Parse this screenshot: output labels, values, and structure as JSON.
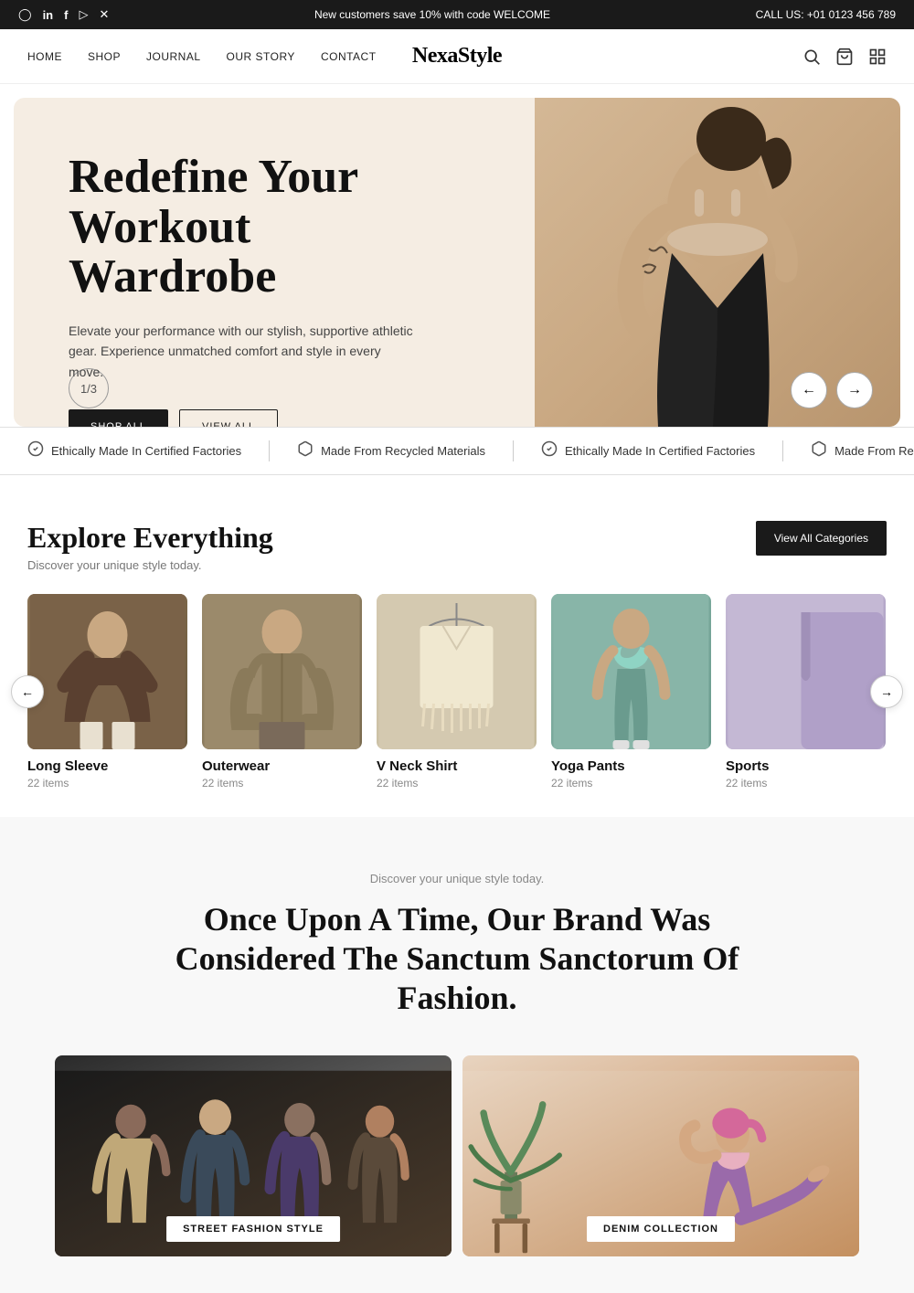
{
  "topbar": {
    "promo": "New customers save 10% with code WELCOME",
    "call": "CALL US: +01 0123 456 789",
    "social": [
      "instagram",
      "linkedin",
      "facebook",
      "youtube",
      "x"
    ]
  },
  "nav": {
    "logo": "NexaStyle",
    "links": [
      "HOME",
      "SHOP",
      "JOURNAL",
      "OUR STORY",
      "CONTACT"
    ]
  },
  "hero": {
    "title": "Redefine Your Workout Wardrobe",
    "subtitle": "Elevate your performance with our stylish, supportive athletic gear. Experience unmatched comfort and style in every move.",
    "btn_shop": "SHOP ALL",
    "btn_view": "VIEW ALL",
    "slide_indicator": "1/3"
  },
  "ticker": {
    "items": [
      {
        "icon": "✓",
        "label": "Ethically Made In Certified Factories"
      },
      {
        "icon": "♻",
        "label": "Made From Recycled Materials"
      },
      {
        "icon": "✓",
        "label": "Ethically Made In Certified Factories"
      },
      {
        "icon": "♻",
        "label": "Made From Recycled Materials"
      }
    ]
  },
  "explore": {
    "title": "Explore Everything",
    "subtitle": "Discover your unique style today.",
    "view_all_btn": "View All Categories",
    "categories": [
      {
        "name": "Long Sleeve",
        "count": "22 items"
      },
      {
        "name": "Outerwear",
        "count": "22 items"
      },
      {
        "name": "V Neck Shirt",
        "count": "22 items"
      },
      {
        "name": "Yoga Pants",
        "count": "22 items"
      },
      {
        "name": "Sports",
        "count": "22 items"
      }
    ]
  },
  "brand_story": {
    "sub": "Discover your unique style today.",
    "title": "Once Upon A Time, Our Brand Was Considered The Sanctum Sanctorum Of Fashion.",
    "collections": [
      {
        "label": "STREET FASHION STYLE"
      },
      {
        "label": "DENIM COLLECTION"
      }
    ]
  }
}
